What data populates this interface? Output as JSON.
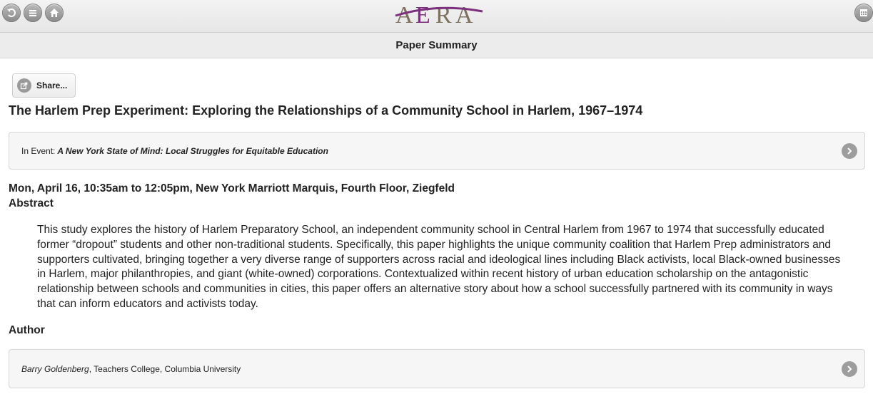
{
  "topbar": {
    "left_icons": [
      "back-icon",
      "menu-icon",
      "home-icon"
    ],
    "right_icon": "calendar-icon",
    "logo_text": "AERA",
    "logo_colors": {
      "a": "#7d7160",
      "e": "#7c2f7d",
      "r": "#7d7160",
      "swoosh": "#7c2f7d"
    }
  },
  "header": {
    "title": "Paper Summary"
  },
  "share": {
    "label": "Share...",
    "icon": "share-icon"
  },
  "paper": {
    "title": "The Harlem Prep Experiment: Exploring the Relationships of a Community School in Harlem, 1967–1974"
  },
  "event": {
    "prefix": "In Event: ",
    "name": "A New York State of Mind: Local Struggles for Equitable Education"
  },
  "session": {
    "datetime_location": "Mon, April 16, 10:35am to 12:05pm, New York Marriott Marquis, Fourth Floor, Ziegfeld"
  },
  "abstract": {
    "heading": "Abstract",
    "text": "This study explores the history of Harlem Preparatory School, an independent community school in Central Harlem from 1967 to 1974 that successfully educated former “dropout” students and other non-traditional students. Specifically, this paper highlights the unique community coalition that Harlem Prep administrators and supporters cultivated, bringing together a very diverse range of supporters across racial and ideological lines including Black activists, local Black-owned businesses in Harlem, major philanthropies, and giant (white-owned) corporations. Contextualized within recent history of urban education scholarship on the antagonistic relationship between schools and communities in cities, this paper offers an alternative story about how a school successfully partnered with its community in ways that can inform educators and activists today."
  },
  "author": {
    "heading": "Author",
    "name": "Barry Goldenberg",
    "affiliation": ", Teachers College, Columbia University"
  }
}
